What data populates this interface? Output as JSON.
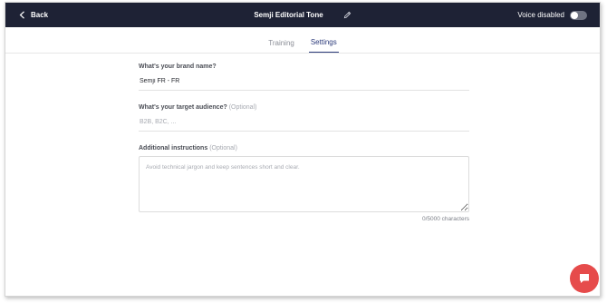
{
  "header": {
    "back_label": "Back",
    "title": "Semji Editorial Tone",
    "voice_label": "Voice disabled",
    "voice_enabled": false,
    "background_color": "#1e2235"
  },
  "tabs": [
    {
      "label": "Training",
      "active": false
    },
    {
      "label": "Settings",
      "active": true
    }
  ],
  "form": {
    "brand_name": {
      "label": "What's your brand name?",
      "value": "Semji FR - FR",
      "placeholder": ""
    },
    "audience": {
      "label": "What's your target audience?",
      "optional_label": "(Optional)",
      "value": "",
      "placeholder": "B2B, B2C, ..."
    },
    "instructions": {
      "label": "Additional instructions",
      "optional_label": "(Optional)",
      "value": "",
      "placeholder": "Avoid technical jargon and keep sentences short and clear.",
      "char_count": "0/5000 characters"
    }
  },
  "icons": {
    "back": "chevron-left-icon",
    "edit": "pencil-icon",
    "chat": "chat-bubble-icon"
  },
  "colors": {
    "accent": "#2b3a7a",
    "chat_button": "#e64b4b"
  }
}
